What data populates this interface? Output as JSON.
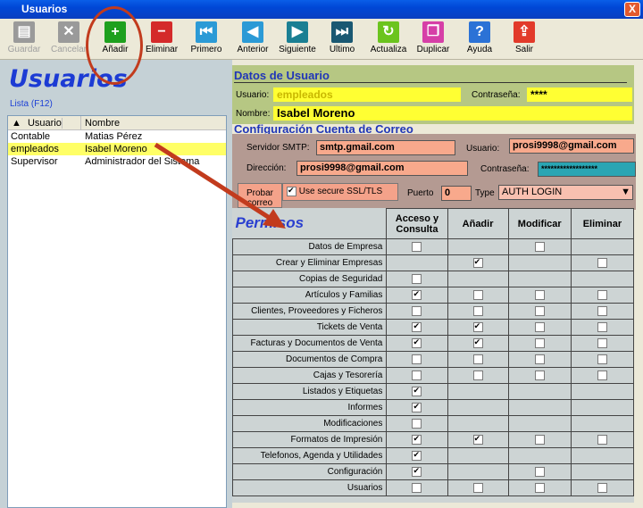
{
  "window": {
    "title": "Usuarios",
    "close": "X"
  },
  "toolbar": [
    {
      "label": "Guardar",
      "icon": "save-icon",
      "color": "#9a9a9a",
      "disabled": true
    },
    {
      "label": "Cancelar",
      "icon": "cancel-icon",
      "color": "#9a9a9a",
      "disabled": true
    },
    {
      "label": "Añadir",
      "icon": "add-icon",
      "color": "#1ea01e",
      "disabled": false
    },
    {
      "label": "Eliminar",
      "icon": "delete-icon",
      "color": "#d42a2a",
      "disabled": false
    },
    {
      "label": "Primero",
      "icon": "first-icon",
      "color": "#2b9ad6",
      "disabled": false
    },
    {
      "label": "Anterior",
      "icon": "previous-icon",
      "color": "#2b9ad6",
      "disabled": false
    },
    {
      "label": "Siguiente",
      "icon": "next-icon",
      "color": "#1a7f93",
      "disabled": false
    },
    {
      "label": "Ultimo",
      "icon": "last-icon",
      "color": "#1a5872",
      "disabled": false
    },
    {
      "label": "Actualiza",
      "icon": "refresh-icon",
      "color": "#6bc41e",
      "disabled": false
    },
    {
      "label": "Duplicar",
      "icon": "duplicate-icon",
      "color": "#d63fa7",
      "disabled": false
    },
    {
      "label": "Ayuda",
      "icon": "help-icon",
      "color": "#2b72d6",
      "disabled": false
    },
    {
      "label": "Salir",
      "icon": "exit-icon",
      "color": "#e23a2a",
      "disabled": false
    }
  ],
  "left": {
    "title": "Usuarios",
    "lista": "Lista (F12)",
    "columns": [
      "Usuario",
      "Nombre"
    ],
    "rows": [
      {
        "usuario": "Contable",
        "nombre": "Matias Pérez"
      },
      {
        "usuario": "empleados",
        "nombre": "Isabel Moreno"
      },
      {
        "usuario": "Supervisor",
        "nombre": "Administrador del Sistema"
      }
    ]
  },
  "datos": {
    "header": "Datos de Usuario",
    "usuario_label": "Usuario:",
    "usuario": "empleados",
    "contrasena_label": "Contraseña:",
    "contrasena": "****",
    "nombre_label": "Nombre:",
    "nombre": "Isabel Moreno"
  },
  "correo": {
    "header": "Configuración Cuenta de Correo",
    "smtp_label": "Servidor SMTP:",
    "smtp": "smtp.gmail.com",
    "usuario_label": "Usuario:",
    "usuario": "prosi9998@gmail.com",
    "direccion_label": "Dirección:",
    "direccion": "prosi9998@gmail.com",
    "contrasena_label": "Contraseña:",
    "contrasena": "******************",
    "ssl_label": "Use secure SSL/TLS",
    "puerto_label": "Puerto",
    "puerto": "0",
    "type_label": "Type",
    "type": "AUTH LOGIN",
    "probar": "Probar correo"
  },
  "permisos": {
    "title": "Permisos",
    "columns": [
      "Acceso y Consulta",
      "Añadir",
      "Modificar",
      "Eliminar"
    ],
    "rows": [
      {
        "name": "Datos de Empresa",
        "v": [
          0,
          null,
          0,
          null
        ]
      },
      {
        "name": "Crear y Eliminar Empresas",
        "v": [
          null,
          1,
          null,
          0
        ]
      },
      {
        "name": "Copias de Seguridad",
        "v": [
          0,
          null,
          null,
          null
        ]
      },
      {
        "name": "Artículos y Familias",
        "v": [
          1,
          0,
          0,
          0
        ]
      },
      {
        "name": "Clientes, Proveedores y Ficheros",
        "v": [
          0,
          0,
          0,
          0
        ]
      },
      {
        "name": "Tickets de Venta",
        "v": [
          1,
          1,
          0,
          0
        ]
      },
      {
        "name": "Facturas y Documentos de Venta",
        "v": [
          1,
          1,
          0,
          0
        ]
      },
      {
        "name": "Documentos de Compra",
        "v": [
          0,
          0,
          0,
          0
        ]
      },
      {
        "name": "Cajas y Tesorería",
        "v": [
          0,
          0,
          0,
          0
        ]
      },
      {
        "name": "Listados y Etiquetas",
        "v": [
          1,
          null,
          null,
          null
        ]
      },
      {
        "name": "Informes",
        "v": [
          1,
          null,
          null,
          null
        ]
      },
      {
        "name": "Modificaciones",
        "v": [
          0,
          null,
          null,
          null
        ]
      },
      {
        "name": "Formatos de Impresión",
        "v": [
          1,
          1,
          0,
          0
        ]
      },
      {
        "name": "Telefonos, Agenda y Utilidades",
        "v": [
          1,
          null,
          null,
          null
        ]
      },
      {
        "name": "Configuración",
        "v": [
          1,
          null,
          0,
          null
        ]
      },
      {
        "name": "Usuarios",
        "v": [
          0,
          0,
          0,
          0
        ]
      }
    ]
  }
}
